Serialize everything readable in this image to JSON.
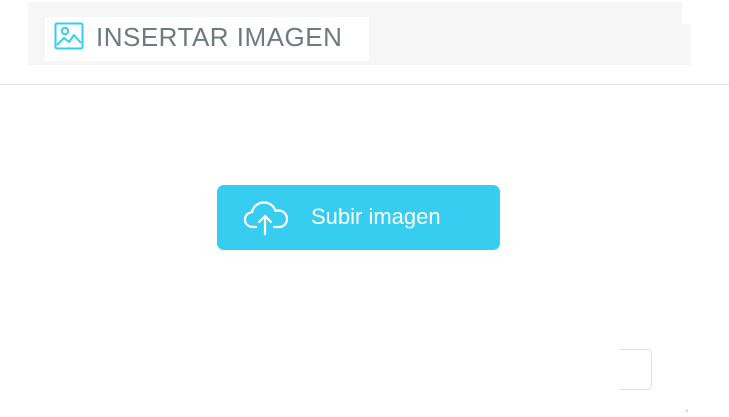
{
  "header": {
    "title": "INSERTAR IMAGEN",
    "icon": "image-icon",
    "title_color": "#6d7b7b",
    "icon_color": "#36cdf1"
  },
  "upload": {
    "label": "Subir imagen",
    "icon": "cloud-upload-icon",
    "background_color": "#36cdf1",
    "text_color": "#ffffff"
  }
}
